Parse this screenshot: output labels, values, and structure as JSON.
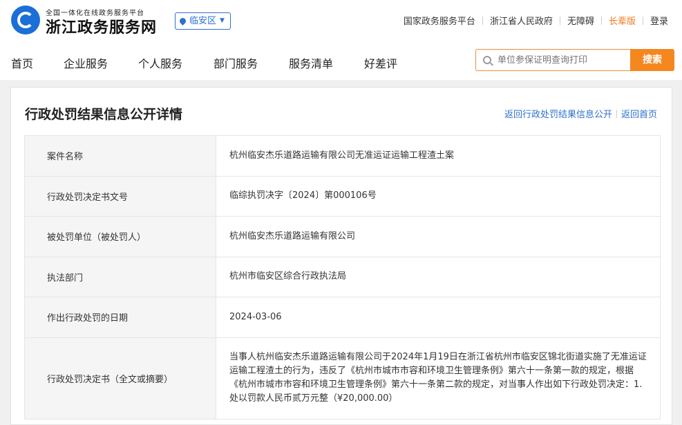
{
  "header": {
    "logo_sub": "全国一体化在线政务服务平台",
    "logo_title": "浙江政务服务网",
    "region": "临安区",
    "top_links": [
      "国家政务服务平台",
      "浙江省人民政府",
      "无障碍",
      "长辈版",
      "登录"
    ]
  },
  "nav": {
    "items": [
      "首页",
      "企业服务",
      "个人服务",
      "部门服务",
      "服务清单",
      "好差评"
    ],
    "search_placeholder": "单位参保证明查询打印",
    "search_button": "搜索"
  },
  "page": {
    "title": "行政处罚结果信息公开详情",
    "link_back_list": "返回行政处罚结果信息公开",
    "link_home": "返回首页"
  },
  "details": [
    {
      "label": "案件名称",
      "value": "杭州临安杰乐道路运输有限公司无准运证运输工程渣土案"
    },
    {
      "label": "行政处罚决定书文号",
      "value": "临综执罚决字〔2024〕第000106号"
    },
    {
      "label": "被处罚单位（被处罚人）",
      "value": "杭州临安杰乐道路运输有限公司"
    },
    {
      "label": "执法部门",
      "value": "杭州市临安区综合行政执法局"
    },
    {
      "label": "作出行政处罚的日期",
      "value": "2024-03-06"
    },
    {
      "label": "行政处罚决定书（全文或摘要）",
      "value": "当事人杭州临安杰乐道路运输有限公司于2024年1月19日在浙江省杭州市临安区锦北街道实施了无准运证运输工程渣土的行为，违反了《杭州市城市市容和环境卫生管理条例》第六十一条第一款的规定，根据《杭州市城市市容和环境卫生管理条例》第六十一条第二款的规定，对当事人作出如下行政处罚决定：1.处以罚款人民币贰万元整（¥20,000.00）"
    }
  ],
  "colors": {
    "brand_blue": "#1b6fd6",
    "link_blue": "#2d6fcf",
    "accent_orange": "#f5871f"
  }
}
